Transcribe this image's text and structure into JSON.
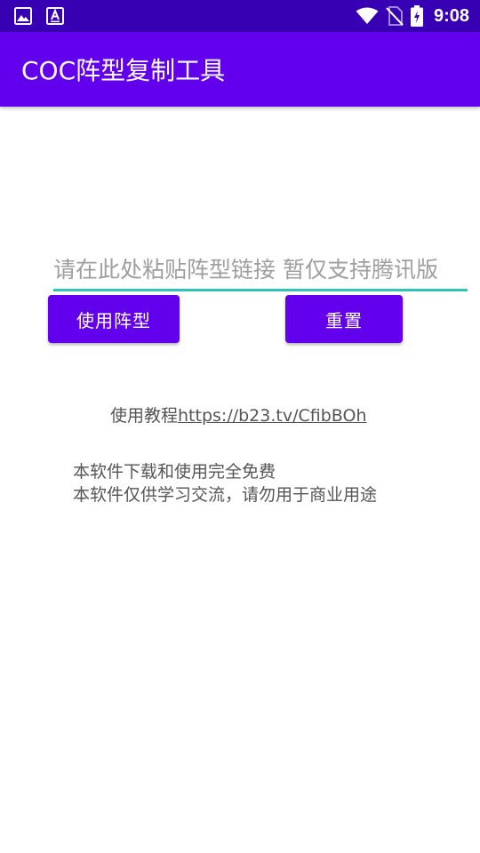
{
  "status_bar": {
    "time": "9:08",
    "left_icons": [
      "image-icon",
      "text-a-icon"
    ],
    "right_icons": [
      "wifi-icon",
      "no-sim-icon",
      "battery-charging-icon"
    ]
  },
  "app_bar": {
    "title": "COC阵型复制工具"
  },
  "link_input": {
    "placeholder": "请在此处粘贴阵型链接 暂仅支持腾讯版",
    "value": ""
  },
  "buttons": {
    "use_label": "使用阵型",
    "reset_label": "重置"
  },
  "tutorial": {
    "label": "使用教程",
    "link": "https://b23.tv/CfibBOh"
  },
  "notices": [
    "本软件下载和使用完全免费",
    "本软件仅供学习交流，请勿用于商业用途"
  ],
  "colors": {
    "status_bar": "#3700b3",
    "primary": "#6200ee",
    "input_underline": "#2ec4b6"
  }
}
